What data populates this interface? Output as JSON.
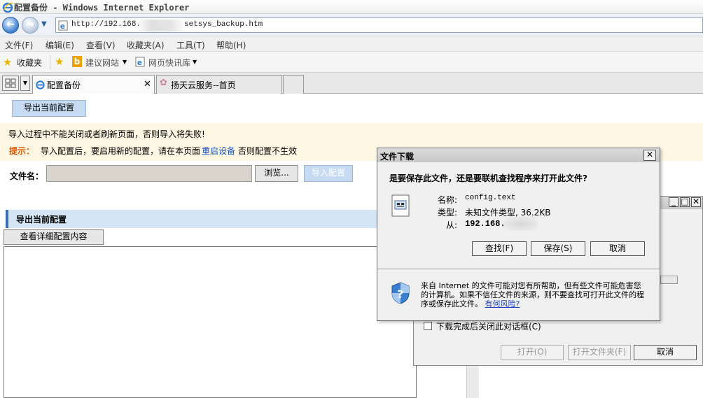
{
  "window": {
    "title": "配置备份 - Windows Internet Explorer"
  },
  "address": {
    "url_prefix": "http://192.168.",
    "url_suffix": "setsys_backup.htm"
  },
  "menu": [
    "文件(F)",
    "编辑(E)",
    "查看(V)",
    "收藏夹(A)",
    "工具(T)",
    "帮助(H)"
  ],
  "favorites": {
    "label": "收藏夹",
    "suggested": "建议网站",
    "webslice": "网页快讯库"
  },
  "tabs": [
    {
      "label": "配置备份",
      "close": "✕"
    },
    {
      "label": "扬天云服务--首页"
    }
  ],
  "page": {
    "export_button": "导出当前配置",
    "warning": "导入过程中不能关闭或者刷新页面，否则导入将失败!",
    "tip_label": "提示：",
    "tip_text": "导入配置后，要启用新的配置，请在本页面",
    "tip_link": "重启设备",
    "tip_end": "否则配置不生效",
    "file_label": "文件名：",
    "browse_button": "浏览...",
    "import_button": "导入配置",
    "section_title": "导出当前配置",
    "view_button": "查看详细配置内容"
  },
  "back_dialog": {
    "checkbox_label": "下载完成后关闭此对话框(C)",
    "open_button": "打开(O)",
    "open_folder_button": "打开文件夹(F)",
    "cancel_button": "取消"
  },
  "dialog": {
    "title": "文件下载",
    "question": "是要保存此文件，还是要联机查找程序来打开此文件?",
    "name_label": "名称:",
    "name_value": "config.text",
    "type_label": "类型:",
    "type_value": "未知文件类型, 36.2KB",
    "from_label": "从:",
    "from_value": "192.168.",
    "find_button": "查找(F)",
    "save_button": "保存(S)",
    "cancel_button": "取消",
    "warning_text": "来自 Internet 的文件可能对您有所帮助，但有些文件可能危害您的计算机。如果不信任文件的来源，则不要查找可打开此文件的程序或保存此文件。",
    "risk_link": "有何风险?"
  }
}
